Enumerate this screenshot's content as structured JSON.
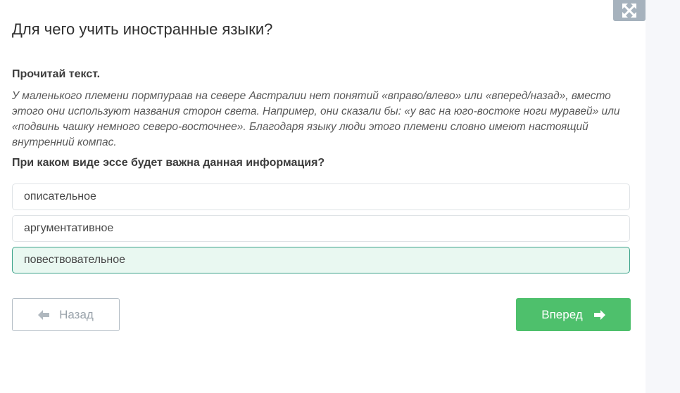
{
  "header": {
    "title": "Для чего учить иностранные языки?",
    "expand_icon": "expand-arrows-icon"
  },
  "task": {
    "instruction": "Прочитай текст.",
    "passage": "У маленького племени пормпураав на севере Австралии нет понятий «вправо/влево» или «вперед/назад», вместо этого они используют названия сторон света. Например, они сказали бы: «у вас на юго-востоке ноги муравей» или «подвинь чашку немного северо-восточнее». Благодаря языку люди этого племени словно имеют настоящий внутренний компас.",
    "question": "При каком виде эссе будет важна данная информация?"
  },
  "options": [
    {
      "label": "описательное",
      "selected": false
    },
    {
      "label": "аргументативное",
      "selected": false
    },
    {
      "label": "повествовательное",
      "selected": true
    }
  ],
  "navigation": {
    "back_label": "Назад",
    "back_icon": "arrow-left-icon",
    "next_label": "Вперед",
    "next_icon": "arrow-right-icon"
  },
  "colors": {
    "accent_green": "#4ec06c",
    "selected_bg": "#e9f8f1",
    "selected_border": "#3aa289"
  }
}
